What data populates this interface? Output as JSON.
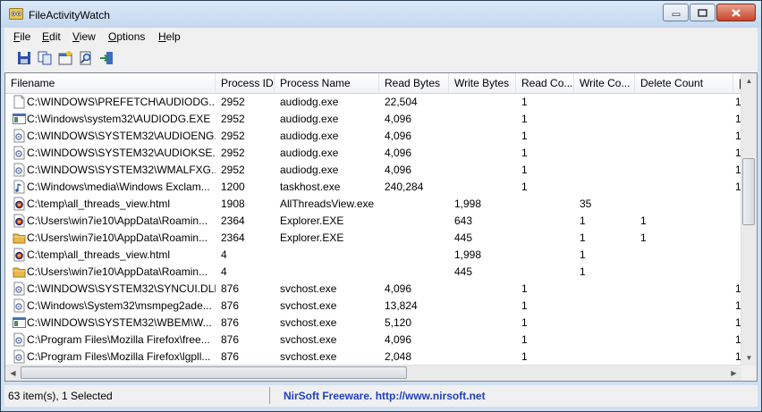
{
  "window": {
    "title": "FileActivityWatch"
  },
  "menu": [
    {
      "key": "F",
      "rest": "ile"
    },
    {
      "key": "E",
      "rest": "dit"
    },
    {
      "key": "V",
      "rest": "iew"
    },
    {
      "key": "O",
      "rest": "ptions"
    },
    {
      "key": "H",
      "rest": "elp"
    }
  ],
  "toolbar": [
    "save-icon",
    "copy-icon",
    "properties-icon",
    "find-icon",
    "exit-icon"
  ],
  "columns": [
    "Filename",
    "Process ID",
    "Process Name",
    "Read Bytes",
    "Write Bytes",
    "Read Co...",
    "Write Co...",
    "Delete Count"
  ],
  "rows": [
    {
      "icon": "file",
      "filename": "C:\\WINDOWS\\PREFETCH\\AUDIODG....",
      "pid": "2952",
      "pname": "audiodg.exe",
      "read": "22,504",
      "write": "",
      "readc": "1",
      "writec": "",
      "delc": ""
    },
    {
      "icon": "exe",
      "filename": "C:\\Windows\\system32\\AUDIODG.EXE",
      "pid": "2952",
      "pname": "audiodg.exe",
      "read": "4,096",
      "write": "",
      "readc": "1",
      "writec": "",
      "delc": ""
    },
    {
      "icon": "dll",
      "filename": "C:\\WINDOWS\\SYSTEM32\\AUDIOENG....",
      "pid": "2952",
      "pname": "audiodg.exe",
      "read": "4,096",
      "write": "",
      "readc": "1",
      "writec": "",
      "delc": ""
    },
    {
      "icon": "dll",
      "filename": "C:\\WINDOWS\\SYSTEM32\\AUDIOKSE....",
      "pid": "2952",
      "pname": "audiodg.exe",
      "read": "4,096",
      "write": "",
      "readc": "1",
      "writec": "",
      "delc": ""
    },
    {
      "icon": "dll",
      "filename": "C:\\WINDOWS\\SYSTEM32\\WMALFXG....",
      "pid": "2952",
      "pname": "audiodg.exe",
      "read": "4,096",
      "write": "",
      "readc": "1",
      "writec": "",
      "delc": ""
    },
    {
      "icon": "audio",
      "filename": "C:\\Windows\\media\\Windows Exclam...",
      "pid": "1200",
      "pname": "taskhost.exe",
      "read": "240,284",
      "write": "",
      "readc": "1",
      "writec": "",
      "delc": ""
    },
    {
      "icon": "html",
      "filename": "C:\\temp\\all_threads_view.html",
      "pid": "1908",
      "pname": "AllThreadsView.exe",
      "read": "",
      "write": "1,998",
      "readc": "",
      "writec": "35",
      "delc": ""
    },
    {
      "icon": "html",
      "filename": "C:\\Users\\win7ie10\\AppData\\Roamin...",
      "pid": "2364",
      "pname": "Explorer.EXE",
      "read": "",
      "write": "643",
      "readc": "",
      "writec": "1",
      "delc": "1"
    },
    {
      "icon": "folder",
      "filename": "C:\\Users\\win7ie10\\AppData\\Roamin...",
      "pid": "2364",
      "pname": "Explorer.EXE",
      "read": "",
      "write": "445",
      "readc": "",
      "writec": "1",
      "delc": "1"
    },
    {
      "icon": "html",
      "filename": "C:\\temp\\all_threads_view.html",
      "pid": "4",
      "pname": "",
      "read": "",
      "write": "1,998",
      "readc": "",
      "writec": "1",
      "delc": ""
    },
    {
      "icon": "folder",
      "filename": "C:\\Users\\win7ie10\\AppData\\Roamin...",
      "pid": "4",
      "pname": "",
      "read": "",
      "write": "445",
      "readc": "",
      "writec": "1",
      "delc": ""
    },
    {
      "icon": "dll",
      "filename": "C:\\WINDOWS\\SYSTEM32\\SYNCUI.DLL",
      "pid": "876",
      "pname": "svchost.exe",
      "read": "4,096",
      "write": "",
      "readc": "1",
      "writec": "",
      "delc": ""
    },
    {
      "icon": "dll",
      "filename": "C:\\Windows\\System32\\msmpeg2ade...",
      "pid": "876",
      "pname": "svchost.exe",
      "read": "13,824",
      "write": "",
      "readc": "1",
      "writec": "",
      "delc": ""
    },
    {
      "icon": "exe",
      "filename": "C:\\WINDOWS\\SYSTEM32\\WBEM\\W...",
      "pid": "876",
      "pname": "svchost.exe",
      "read": "5,120",
      "write": "",
      "readc": "1",
      "writec": "",
      "delc": ""
    },
    {
      "icon": "dll",
      "filename": "C:\\Program Files\\Mozilla Firefox\\free...",
      "pid": "876",
      "pname": "svchost.exe",
      "read": "4,096",
      "write": "",
      "readc": "1",
      "writec": "",
      "delc": ""
    },
    {
      "icon": "dll",
      "filename": "C:\\Program Files\\Mozilla Firefox\\lgpll...",
      "pid": "876",
      "pname": "svchost.exe",
      "read": "2,048",
      "write": "",
      "readc": "1",
      "writec": "",
      "delc": ""
    }
  ],
  "status": {
    "count": "63 item(s), 1 Selected",
    "link": "NirSoft Freeware.  http://www.nirsoft.net"
  }
}
